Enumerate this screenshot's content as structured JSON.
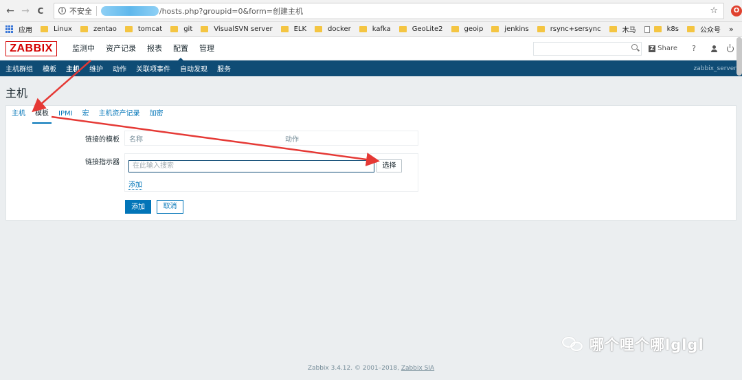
{
  "browser": {
    "back_glyph": "←",
    "forward_glyph": "→",
    "reload_glyph": "C",
    "home_glyph": "⌂",
    "warn_glyph": "i",
    "insecure_label": "不安全",
    "url_path": "/hosts.php?groupid=0&form=创建主机",
    "star_glyph": "☆",
    "ext_glyph": "O"
  },
  "bookmarks": {
    "apps_label": "应用",
    "items": [
      "Linux",
      "zentao",
      "tomcat",
      "git",
      "VisualSVN server",
      "ELK",
      "docker",
      "kafka",
      "GeoLite2",
      "geoip",
      "jenkins",
      "rsync+sersync",
      "木马",
      "k8s",
      "公众号"
    ],
    "more_glyph": "»"
  },
  "header": {
    "logo": "ZABBIX",
    "menu": [
      "监测中",
      "资产记录",
      "报表",
      "配置",
      "管理"
    ],
    "selected_menu": "配置",
    "search_placeholder": "",
    "share_label": "Share",
    "share_glyph": "Z",
    "help_glyph": "?"
  },
  "sub_menu": {
    "items": [
      "主机群组",
      "模板",
      "主机",
      "维护",
      "动作",
      "关联项事件",
      "自动发现",
      "服务"
    ],
    "active": "主机",
    "server_name": "zabbix_server"
  },
  "page": {
    "title": "主机"
  },
  "form": {
    "tabs": [
      "主机",
      "模板",
      "IPMI",
      "宏",
      "主机资产记录",
      "加密"
    ],
    "active_tab": "模板",
    "linked_templates_label": "链接的模板",
    "col_name": "名称",
    "col_action": "动作",
    "link_indicator_label": "链接指示器",
    "search_placeholder": "在此输入搜索",
    "select_button": "选择",
    "add_link": "添加",
    "add_button": "添加",
    "cancel_button": "取消"
  },
  "watermark": {
    "text": "哪个哩个哪lglgl"
  },
  "footer": {
    "prefix": "Zabbix 3.4.12. © 2001–2018, ",
    "link": "Zabbix SIA"
  },
  "colors": {
    "zabbix_red": "#d40000",
    "submenu_bg": "#0f4c75",
    "link_blue": "#0275b8",
    "annotation_red": "#e53935"
  }
}
